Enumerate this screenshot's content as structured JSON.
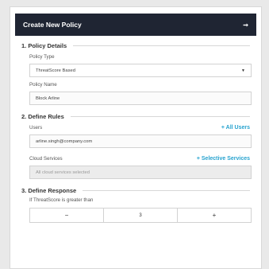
{
  "header": {
    "title": "Create New Policy",
    "collapse_icon": "arrow-right-icon"
  },
  "policy_details": {
    "section_title": "1. Policy Details",
    "policy_type_label": "Policy Type",
    "policy_type_value": "ThreatScore Based",
    "policy_name_label": "Policy Name",
    "policy_name_value": "Block Arline"
  },
  "define_rules": {
    "section_title": "2. Define Rules",
    "users_label": "Users",
    "all_users_link": "+ All Users",
    "users_value": "arline.singh@company.com",
    "cloud_services_label": "Cloud Services",
    "selective_services_link": "+ Selective Services",
    "cloud_services_value": "All cloud services selected"
  },
  "define_response": {
    "section_title": "3. Define Response",
    "threshold_label": "If ThreatScore is greater than",
    "decrement_label": "−",
    "threshold_value": "3",
    "increment_label": "+"
  }
}
